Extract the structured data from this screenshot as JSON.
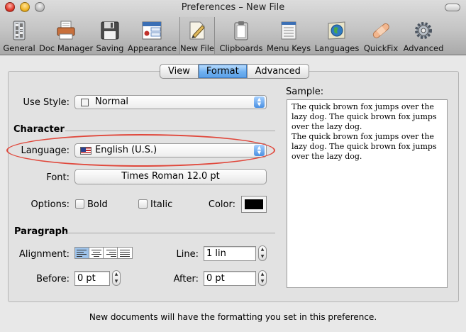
{
  "window": {
    "title": "Preferences – New File"
  },
  "toolbar": {
    "items": [
      {
        "label": "General",
        "icon": "switches-icon"
      },
      {
        "label": "Doc Manager",
        "icon": "printer-icon"
      },
      {
        "label": "Saving",
        "icon": "floppy-disk-icon"
      },
      {
        "label": "Appearance",
        "icon": "window-icon"
      },
      {
        "label": "New File",
        "icon": "new-file-icon",
        "selected": true
      },
      {
        "label": "Clipboards",
        "icon": "clipboard-icon"
      },
      {
        "label": "Menu Keys",
        "icon": "menu-keys-icon"
      },
      {
        "label": "Languages",
        "icon": "globe-icon"
      },
      {
        "label": "QuickFix",
        "icon": "bandage-icon"
      },
      {
        "label": "Advanced",
        "icon": "gear-icon"
      }
    ]
  },
  "tabs": [
    {
      "label": "View"
    },
    {
      "label": "Format",
      "active": true
    },
    {
      "label": "Advanced"
    }
  ],
  "form": {
    "use_style_label": "Use Style:",
    "use_style_value": "Normal",
    "character_heading": "Character",
    "language_label": "Language:",
    "language_value": "English (U.S.)",
    "font_label": "Font:",
    "font_value": "Times Roman 12.0 pt",
    "options_label": "Options:",
    "bold_label": "Bold",
    "italic_label": "Italic",
    "color_label": "Color:",
    "color_value": "#000000",
    "paragraph_heading": "Paragraph",
    "alignment_label": "Alignment:",
    "line_label": "Line:",
    "line_value": "1 lin",
    "before_label": "Before:",
    "before_value": "0 pt",
    "after_label": "After:",
    "after_value": "0 pt"
  },
  "sample": {
    "label": "Sample:",
    "paragraphs": [
      "The quick brown fox jumps over the lazy dog. The quick brown fox jumps over the lazy dog.",
      "The quick brown fox jumps over the lazy dog. The quick brown fox jumps over the lazy dog."
    ]
  },
  "footer": {
    "text": "New documents will have the formatting you set in this preference."
  },
  "colors": {
    "highlight": "#e0483c",
    "accent": "#4a90e2"
  }
}
